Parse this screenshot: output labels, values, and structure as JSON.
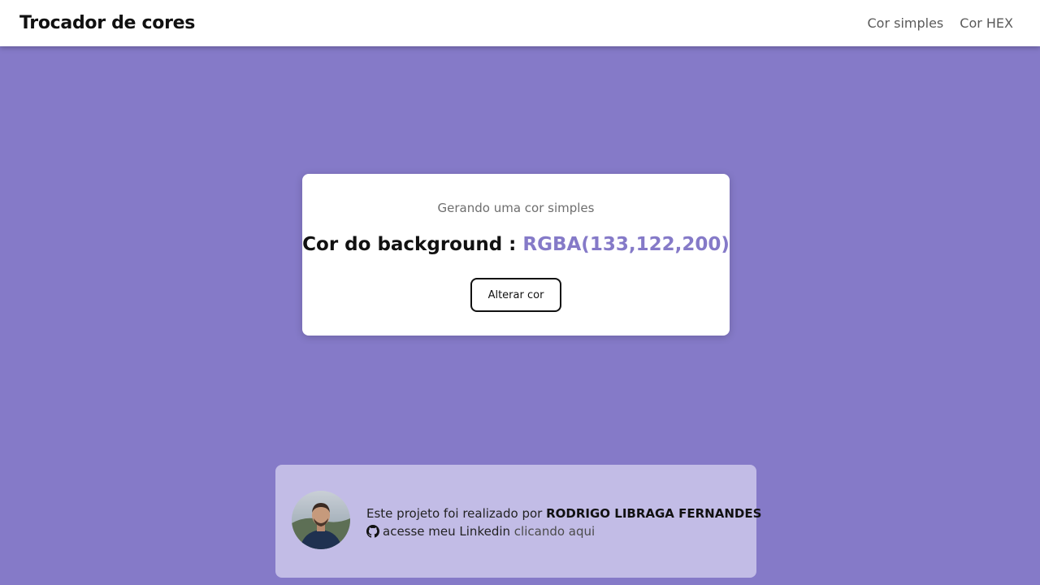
{
  "navbar": {
    "brand": "Trocador de cores",
    "links": [
      "Cor simples",
      "Cor HEX"
    ]
  },
  "card": {
    "subtitle": "Gerando uma cor simples",
    "title_label": "Cor do background : ",
    "color_value": "RGBA(133,122,200)",
    "button_label": "Alterar cor"
  },
  "footer": {
    "made_by": "Este projeto foi realizado por ",
    "author": "RODRIGO LIBRAGA FERNANDES",
    "linkedin_text": "acesse meu Linkedin ",
    "link_label": "clicando aqui"
  },
  "colors": {
    "background": "#857ac8",
    "accent": "#857ac8",
    "footer_bg": "#c2bce6"
  },
  "icons": [
    "github-icon",
    "avatar"
  ]
}
